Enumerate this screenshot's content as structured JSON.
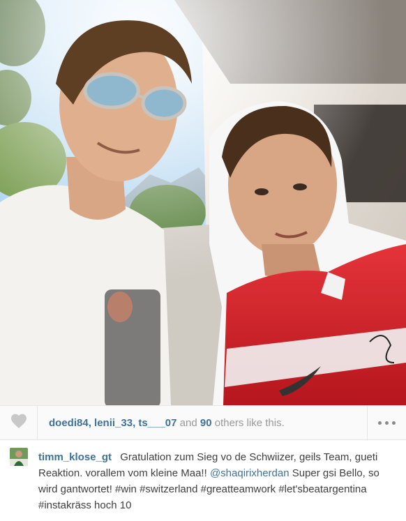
{
  "post": {
    "likes": {
      "users": [
        "doedi84",
        "lenii_33",
        "ts___07"
      ],
      "and_text": "and",
      "others_count": "90",
      "others_text": "others like this."
    },
    "caption": {
      "author": "timm_klose_gt",
      "text_part1": "Gratulation zum Sieg vo de Schwiizer, geils Team, gueti Reaktion. vorallem vom kleine Maa!!",
      "mention": "@shaqirixherdan",
      "text_part2": "Super gsi Bello, so wird gantwortet! #win #switzerland #greatteamwork #let'sbeatargentina #instakräss hoch 10"
    }
  },
  "icons": {
    "like": "heart-icon",
    "more": "more-options-icon"
  },
  "colors": {
    "link": "#3f729b",
    "text": "#3f3f3f",
    "muted": "#999999",
    "bar_bg": "#fafafa"
  }
}
